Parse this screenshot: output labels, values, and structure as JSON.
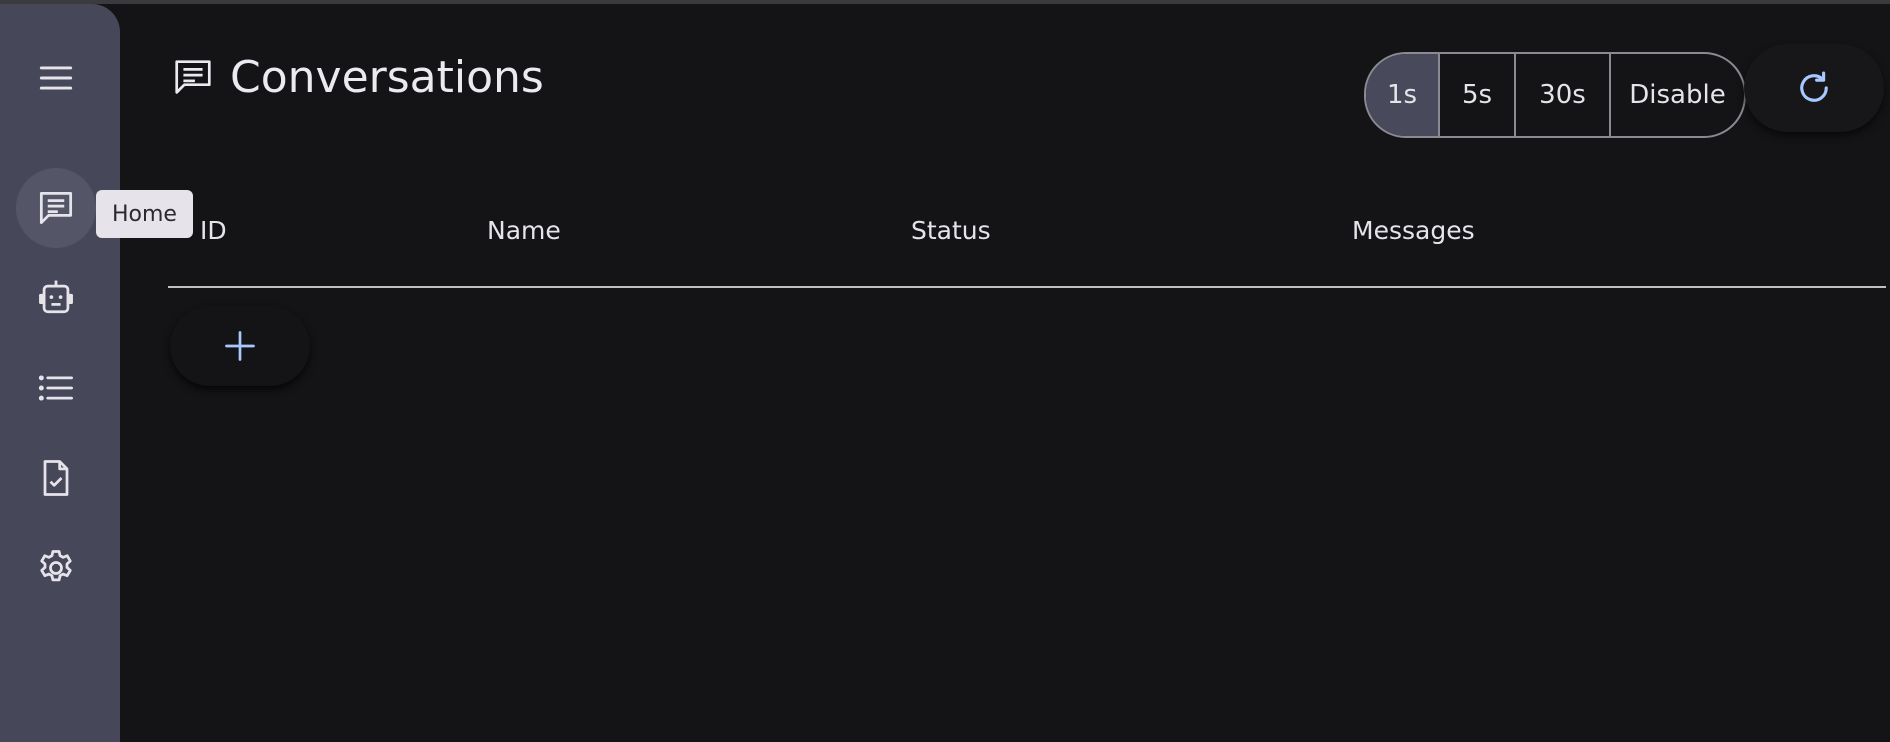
{
  "nav": {
    "items": [
      {
        "icon": "menu-icon"
      },
      {
        "icon": "chat-icon",
        "active": true
      },
      {
        "icon": "robot-icon"
      },
      {
        "icon": "list-icon"
      },
      {
        "icon": "task-file-icon"
      },
      {
        "icon": "gear-icon"
      }
    ],
    "tooltip": "Home"
  },
  "header": {
    "title": "Conversations",
    "title_icon": "chat-icon",
    "refresh_options": [
      {
        "label": "1s",
        "selected": true
      },
      {
        "label": "5s",
        "selected": false
      },
      {
        "label": "30s",
        "selected": false
      },
      {
        "label": "Disable",
        "selected": false
      }
    ],
    "refresh_icon": "refresh-icon"
  },
  "table": {
    "columns": [
      "ID",
      "Name",
      "Status",
      "Messages"
    ],
    "rows": []
  },
  "add_button": {
    "icon": "plus-icon"
  },
  "colors": {
    "background": "#141416",
    "rail": "#464859",
    "rail_active": "#545667",
    "selected_segment": "#484a5b",
    "accent": "#a8c8ff",
    "text": "#e6e3ea"
  }
}
